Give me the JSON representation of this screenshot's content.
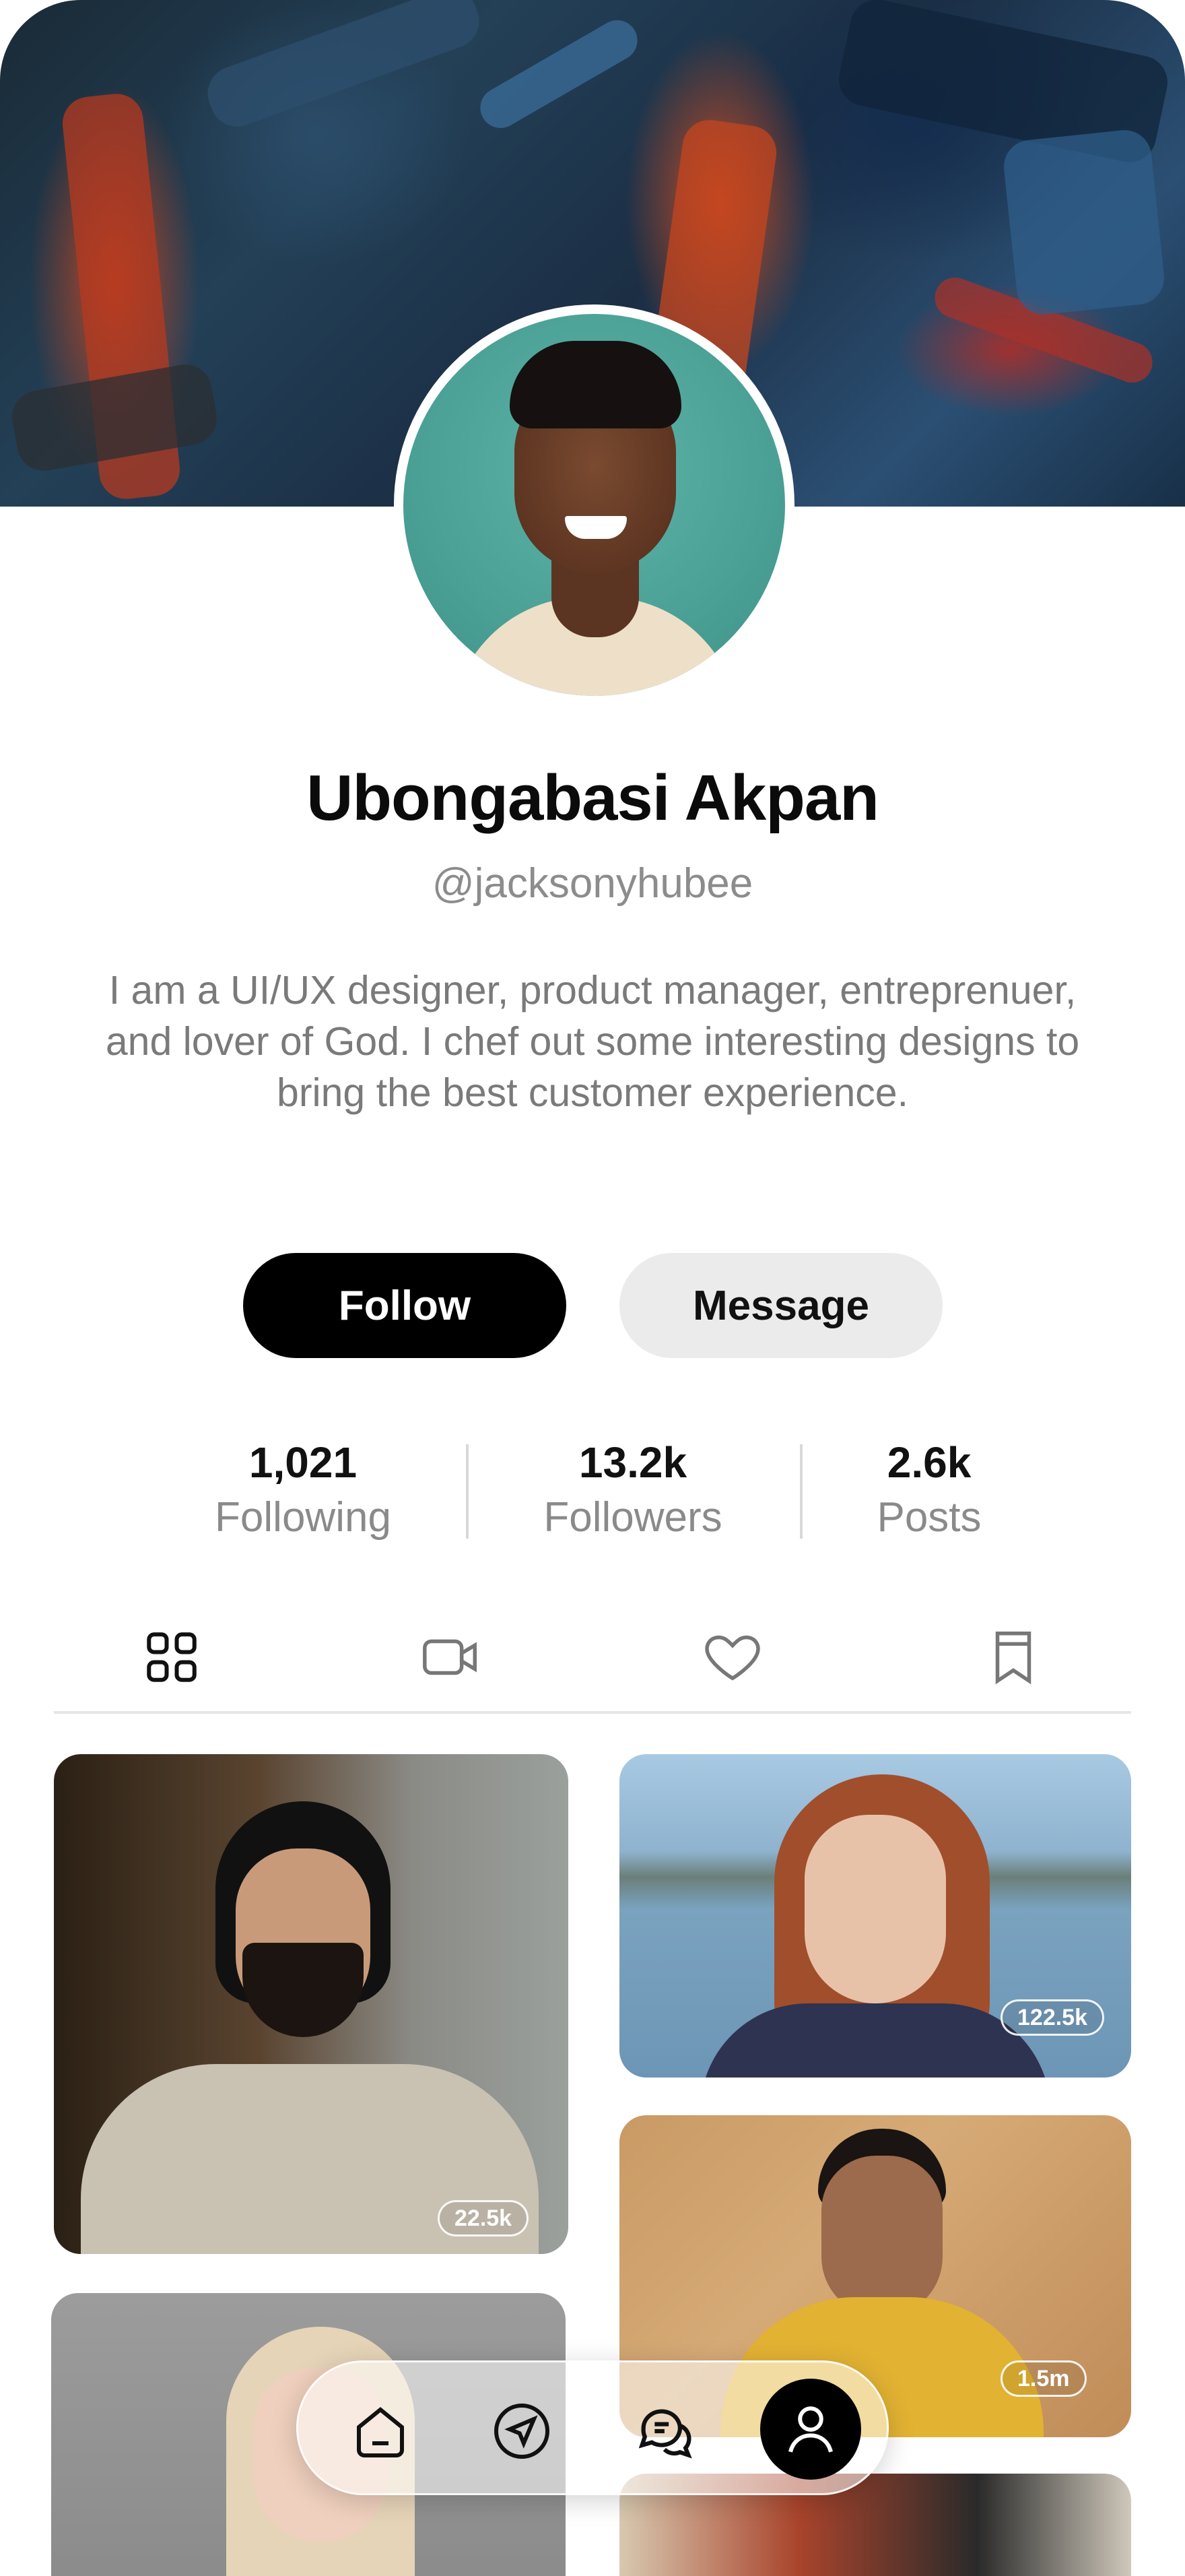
{
  "profile": {
    "name": "Ubongabasi Akpan",
    "handle": "@jacksonyhubee",
    "bio": "I am a UI/UX designer, product manager, entreprenuer, and lover of God. I chef out some interesting designs to bring the best customer experience."
  },
  "actions": {
    "follow_label": "Follow",
    "message_label": "Message"
  },
  "stats": [
    {
      "value": "1,021",
      "label": "Following"
    },
    {
      "value": "13.2k",
      "label": "Followers"
    },
    {
      "value": "2.6k",
      "label": "Posts"
    }
  ],
  "tabs": [
    {
      "icon": "grid-icon",
      "active": true
    },
    {
      "icon": "video-icon",
      "active": false
    },
    {
      "icon": "heart-icon",
      "active": false
    },
    {
      "icon": "bookmark-icon",
      "active": false
    }
  ],
  "posts": [
    {
      "count": "22.5k"
    },
    {
      "count": "122.5k"
    },
    {
      "count": "1.5m"
    }
  ],
  "bottom_nav": [
    {
      "icon": "home-icon",
      "active": false
    },
    {
      "icon": "send-icon",
      "active": false
    },
    {
      "icon": "chat-icon",
      "active": false
    },
    {
      "icon": "profile-icon",
      "active": true
    }
  ],
  "colors": {
    "primary": "#000000",
    "secondary_button": "#ebebeb",
    "muted_text": "#8a8a8a"
  }
}
